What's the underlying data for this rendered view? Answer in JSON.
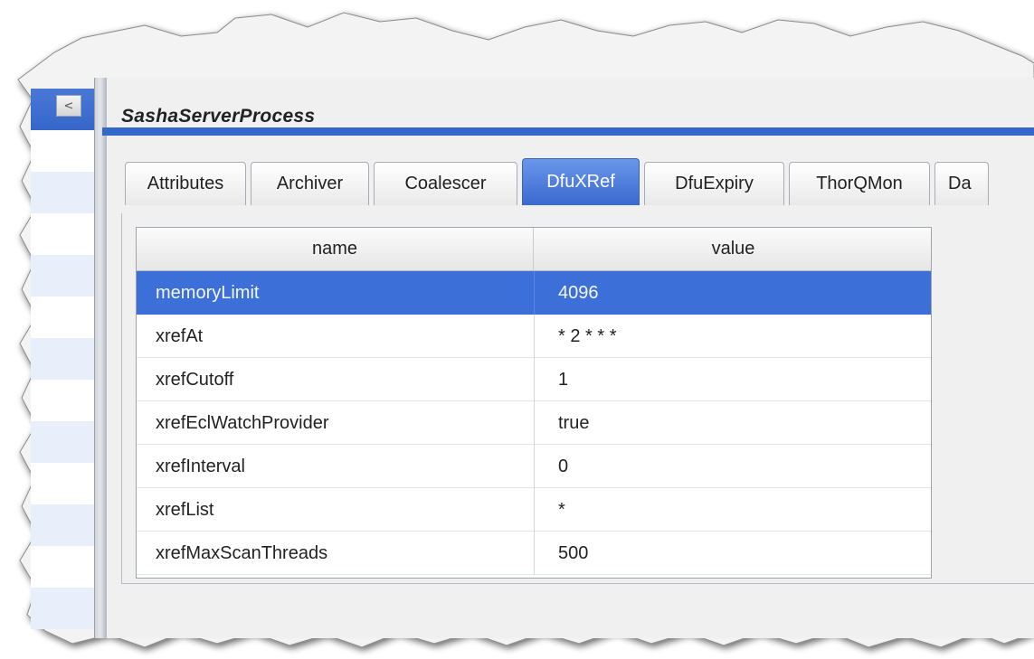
{
  "panel": {
    "title": "SashaServerProcess"
  },
  "left_panel": {
    "collapse_glyph": "<",
    "collapse_icon": "chevron-left-icon"
  },
  "tabs": [
    {
      "label": "Attributes",
      "active": false
    },
    {
      "label": "Archiver",
      "active": false
    },
    {
      "label": "Coalescer",
      "active": false
    },
    {
      "label": "DfuXRef",
      "active": true
    },
    {
      "label": "DfuExpiry",
      "active": false
    },
    {
      "label": "ThorQMon",
      "active": false
    },
    {
      "label": "Da",
      "active": false
    }
  ],
  "grid": {
    "columns": [
      "name",
      "value"
    ],
    "rows": [
      {
        "name": "memoryLimit",
        "value": "4096",
        "selected": true
      },
      {
        "name": "xrefAt",
        "value": "* 2 * * *",
        "selected": false
      },
      {
        "name": "xrefCutoff",
        "value": "1",
        "selected": false
      },
      {
        "name": "xrefEclWatchProvider",
        "value": "true",
        "selected": false
      },
      {
        "name": "xrefInterval",
        "value": "0",
        "selected": false
      },
      {
        "name": "xrefList",
        "value": "*",
        "selected": false
      },
      {
        "name": "xrefMaxScanThreads",
        "value": "500",
        "selected": false
      }
    ]
  },
  "colors": {
    "accent": "#3566c9",
    "selected_row": "#3d6fd8",
    "left_row_alt": "#e8effb"
  }
}
